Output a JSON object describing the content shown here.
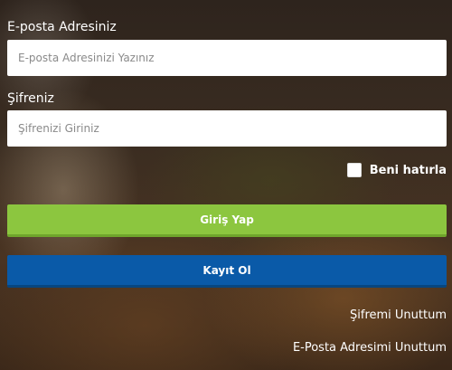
{
  "login_form": {
    "email_label": "E-posta Adresiniz",
    "email_placeholder": "E-posta Adresinizi Yazınız",
    "email_value": "",
    "password_label": "Şifreniz",
    "password_placeholder": "Şifrenizi Giriniz",
    "password_value": "",
    "remember_label": "Beni hatırla",
    "remember_checked": false,
    "login_button": "Giriş Yap",
    "register_button": "Kayıt Ol",
    "forgot_password_link": "Şifremi Unuttum",
    "forgot_email_link": "E-Posta Adresimi Unuttum"
  },
  "colors": {
    "login_button": "#8cc63f",
    "register_button": "#0a5aa8",
    "text": "#ffffff"
  }
}
